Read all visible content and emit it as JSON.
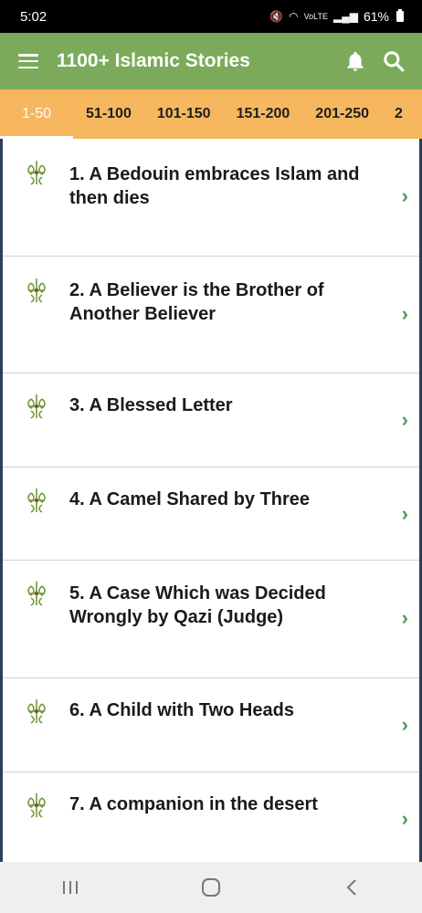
{
  "status": {
    "time": "5:02",
    "battery": "61%",
    "signal_text": "VoLTE"
  },
  "app_bar": {
    "title": "1100+ Islamic Stories"
  },
  "tabs": [
    "1-50",
    "51-100",
    "101-150",
    "151-200",
    "201-250",
    "2"
  ],
  "stories": [
    {
      "title": "1. A Bedouin embraces Islam and then dies"
    },
    {
      "title": "2. A Believer is the Brother of Another Believer"
    },
    {
      "title": "3. A Blessed Letter"
    },
    {
      "title": "4. A Camel Shared by Three"
    },
    {
      "title": "5. A Case Which was Decided Wrongly by Qazi (Judge)"
    },
    {
      "title": "6. A Child with Two Heads"
    },
    {
      "title": "7. A companion in the desert"
    }
  ],
  "colors": {
    "app_bar": "#7bab5a",
    "tabs": "#f6b75f",
    "chevron": "#4e9c5a",
    "border": "#2d3e5a"
  },
  "icons": {
    "menu": "hamburger-menu-icon",
    "bell": "bell-icon",
    "search": "search-icon",
    "story": "ornament-icon",
    "chevron": "chevron-right-icon"
  }
}
